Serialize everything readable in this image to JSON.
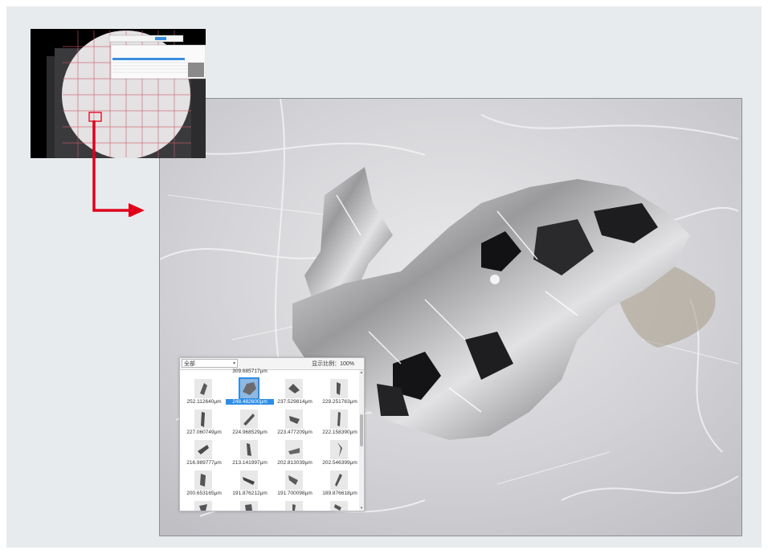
{
  "panel": {
    "filter_value": "全部",
    "scale_text": "显示比例：100%",
    "items": [
      {
        "length": "309.685717μm"
      },
      {
        "length": "252.112640μm"
      },
      {
        "length": "248.482600μm",
        "selected": true
      },
      {
        "length": "237.529814μm"
      },
      {
        "length": "229.251763μm"
      },
      {
        "length": "227.060749μm"
      },
      {
        "length": "224.968529μm"
      },
      {
        "length": "223.477209μm"
      },
      {
        "length": "222.158390μm"
      },
      {
        "length": "216.989777μm"
      },
      {
        "length": "213.141997μm"
      },
      {
        "length": "202.813039μm"
      },
      {
        "length": "202.546399μm"
      },
      {
        "length": "200.653165μm"
      },
      {
        "length": "191.876212μm"
      },
      {
        "length": "191.700098μm"
      },
      {
        "length": "189.876618μm"
      }
    ]
  },
  "colors": {
    "accent_red": "#e0001b",
    "selection_blue": "#2e8de6",
    "background": "#e7ebee"
  },
  "icons": {
    "overview": "microscope-filter-overview",
    "arrow": "arrow-right-icon"
  }
}
